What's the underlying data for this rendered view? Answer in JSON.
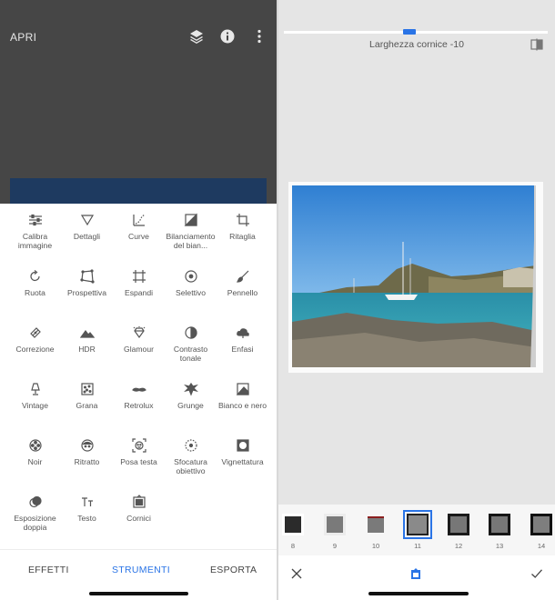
{
  "left": {
    "appbar": {
      "open_label": "APRI",
      "icons": [
        "layers-icon",
        "info-icon",
        "more-vert-icon"
      ]
    },
    "tools": [
      {
        "label": "Calibra immagine",
        "icon": "tune-sliders-icon"
      },
      {
        "label": "Dettagli",
        "icon": "triangle-icon"
      },
      {
        "label": "Curve",
        "icon": "curve-icon"
      },
      {
        "label": "Bilanciamento del bian...",
        "icon": "white-balance-icon"
      },
      {
        "label": "Ritaglia",
        "icon": "crop-icon"
      },
      {
        "label": "Ruota",
        "icon": "rotate-icon"
      },
      {
        "label": "Prospettiva",
        "icon": "perspective-icon"
      },
      {
        "label": "Espandi",
        "icon": "expand-icon"
      },
      {
        "label": "Selettivo",
        "icon": "selective-icon"
      },
      {
        "label": "Pennello",
        "icon": "brush-icon"
      },
      {
        "label": "Correzione",
        "icon": "healing-bandage-icon"
      },
      {
        "label": "HDR",
        "icon": "mountains-icon"
      },
      {
        "label": "Glamour",
        "icon": "diamond-icon"
      },
      {
        "label": "Contrasto tonale",
        "icon": "tonal-contrast-icon"
      },
      {
        "label": "Enfasi",
        "icon": "cloud-icon"
      },
      {
        "label": "Vintage",
        "icon": "lamp-icon"
      },
      {
        "label": "Grana",
        "icon": "grain-icon"
      },
      {
        "label": "Retrolux",
        "icon": "mustache-icon"
      },
      {
        "label": "Grunge",
        "icon": "grunge-icon"
      },
      {
        "label": "Bianco e nero",
        "icon": "black-white-icon"
      },
      {
        "label": "Noir",
        "icon": "film-reel-icon"
      },
      {
        "label": "Ritratto",
        "icon": "portrait-face-icon"
      },
      {
        "label": "Posa testa",
        "icon": "head-pose-icon"
      },
      {
        "label": "Sfocatura obiettivo",
        "icon": "lens-blur-icon"
      },
      {
        "label": "Vignettatura",
        "icon": "vignette-icon"
      },
      {
        "label": "Esposizione doppia",
        "icon": "double-exposure-icon"
      },
      {
        "label": "Testo",
        "icon": "text-icon"
      },
      {
        "label": "Cornici",
        "icon": "frames-icon"
      }
    ],
    "nav": {
      "effects": "EFFETTI",
      "tools": "STRUMENTI",
      "export": "ESPORTA",
      "active": "STRUMENTI"
    }
  },
  "right": {
    "parameter": {
      "label": "Larghezza cornice",
      "value": "-10",
      "display": "Larghezza cornice -10",
      "slider_fraction": 0.475
    },
    "frames": [
      "8",
      "9",
      "10",
      "11",
      "12",
      "13",
      "14"
    ],
    "selected_frame": "11",
    "bottom": {
      "icons": [
        "close-icon",
        "style-icon",
        "check-icon"
      ]
    }
  },
  "colors": {
    "accent": "#2a74e6",
    "dark_panel": "#464646",
    "canvas_bg": "#e5e5e5"
  }
}
